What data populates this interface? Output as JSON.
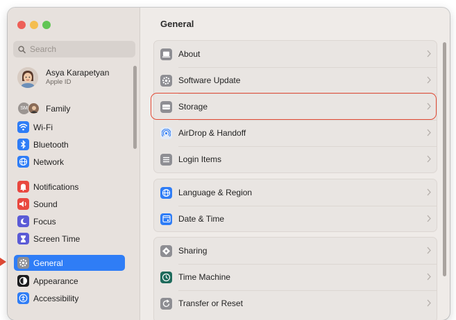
{
  "window": {
    "controls": [
      "close",
      "minimize",
      "maximize"
    ]
  },
  "search": {
    "placeholder": "Search",
    "icon": "search-icon"
  },
  "account": {
    "name": "Asya Karapetyan",
    "subtitle": "Apple ID"
  },
  "family": {
    "badge": "SM",
    "label": "Family"
  },
  "sidebar": {
    "items": [
      {
        "label": "Wi-Fi",
        "icon": "wifi-icon",
        "color": "#2f7df6"
      },
      {
        "label": "Bluetooth",
        "icon": "bluetooth-icon",
        "color": "#2f7df6"
      },
      {
        "label": "Network",
        "icon": "globe-icon",
        "color": "#2f7df6"
      },
      {
        "label": "Notifications",
        "icon": "bell-icon",
        "color": "#e9483f"
      },
      {
        "label": "Sound",
        "icon": "speaker-icon",
        "color": "#e9483f"
      },
      {
        "label": "Focus",
        "icon": "moon-icon",
        "color": "#5b5bd6"
      },
      {
        "label": "Screen Time",
        "icon": "hourglass-icon",
        "color": "#5b5bd6"
      },
      {
        "label": "General",
        "icon": "gear-icon",
        "color": "#8e8e93",
        "selected": true
      },
      {
        "label": "Appearance",
        "icon": "appearance-icon",
        "color": "#1c1c1e"
      },
      {
        "label": "Accessibility",
        "icon": "accessibility-icon",
        "color": "#2f7df6"
      }
    ]
  },
  "main": {
    "title": "General",
    "groups": [
      {
        "rows": [
          {
            "label": "About",
            "icon": "laptop-icon"
          },
          {
            "label": "Software Update",
            "icon": "gear-badge-icon"
          },
          {
            "label": "Storage",
            "icon": "storage-icon",
            "highlighted": true
          },
          {
            "label": "AirDrop & Handoff",
            "icon": "airdrop-icon"
          },
          {
            "label": "Login Items",
            "icon": "list-icon"
          }
        ]
      },
      {
        "rows": [
          {
            "label": "Language & Region",
            "icon": "globe-icon"
          },
          {
            "label": "Date & Time",
            "icon": "calendar-icon"
          }
        ]
      },
      {
        "rows": [
          {
            "label": "Sharing",
            "icon": "sharing-icon"
          },
          {
            "label": "Time Machine",
            "icon": "time-machine-icon"
          },
          {
            "label": "Transfer or Reset",
            "icon": "reset-icon"
          }
        ]
      }
    ]
  },
  "colors": {
    "accent": "#2f7df6",
    "highlight": "#e24b36"
  }
}
